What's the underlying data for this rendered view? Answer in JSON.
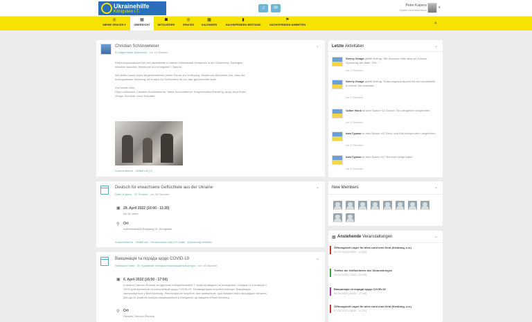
{
  "brand": {
    "name": "Ukrainehilfe",
    "sub": "Königstein i.T."
  },
  "user": {
    "name": "Peter Kuipers",
    "role": "System Administration"
  },
  "nav": [
    {
      "label": "Meine Spaces ▾",
      "icon": "◎"
    },
    {
      "label": "Übersicht",
      "icon": "▦"
    },
    {
      "label": "Mitglieder",
      "icon": "☗"
    },
    {
      "label": "Spaces",
      "icon": "◎"
    },
    {
      "label": "Kalender",
      "icon": "▦"
    },
    {
      "label": "Sachspenden Bestand",
      "icon": "▮"
    },
    {
      "label": "Sachspenden anbieten",
      "icon": "⚑"
    }
  ],
  "posts": [
    {
      "author": "Christian Schönwetener",
      "space": "01 Allgemeiner Austausch",
      "time": "vor 14 Stunden",
      "body": [
        "Erfahrungsaustausch mit der Ukrainehilfe in meiner Heimatstadt Hersbruck in der Schönbera. Synergien",
        "schaffen zwischen Hersbruck und Königstein / Taunus.",
        "",
        "Wir stellen unser super angenommenes Online-Forum zur Verfügung. Hersbruck informierte uns, dass die",
        "Kreisspartasse Nürnberg die Kosten für Geflüchtete für ein Jahr gebührenfrei stellt.",
        "",
        "Von rechts links:",
        "Lilya Luchanska, Christian Schönwetener, Stella Schönwetener, Bürgermeister Robert Ig, Andy Jörgl Roller,",
        "Gregor Schuster, Anna Schuster."
      ],
      "links": "Kommentieren · Gefällt mir (1)"
    },
    {
      "title": "Deutsch für erwachsene Geflüchtete aus der Ukraine",
      "author": "Peter Kuipers",
      "space": "07 Termine",
      "time": "vor 16 Stunden",
      "date": "29. April 2022 (10:00 - 11:30)",
      "date_sub": "Ab 15 Jahre",
      "loc_label": "Ort",
      "loc": "Adelheidstraße Burgweg 16, Königstein",
      "links": "Kommentieren · Gefällt mir · Herunterladen als ICS Datei · Erinnerung erstellen"
    },
    {
      "title": "Вакцинація та порада щодо COVID-19",
      "author": "Sebastian Hahn",
      "space": "09 Праківний телефон/Інформаційний ресурс",
      "time": "vor 16 Stunden",
      "date": "6. April 2022 (16:00 - 17:00)",
      "body": [
        "у лікарні Святого Йосипа за адресою Königsteinstraße 7 лікарі проводять на понеділках, середах та п'ятницях з",
        "14:00 для щеплення та консультацій щодо COVID-19. На вакцинацію потрібен паспорт. Вакцинація",
        "застосовується у Bad Homburg. Реєстрація не потрібна, але запишіться, щоб вказати якісь процедурні питання.",
        "Діти до 12 років не можуть вакцинуватися в Königstein, це вакцина в Bad Homburg."
      ],
      "loc_label": "Ort",
      "loc": "Лікарня Святого Йосипа"
    }
  ],
  "activities": {
    "title_bold": "Letzte",
    "title_rest": "Aktivitäten",
    "items": [
      {
        "name": "Sherry Visage",
        "text": "gefällt Beitrag \"Wir brauchen bitte alles an Outdoor Sportzeug wie Bälle, Frei...\"",
        "time": "vor 2 Stunden"
      },
      {
        "name": "Sherry Visage",
        "text": "gefällt Beitrag \"Erfahrungsaus-tausch mit der Ukrainehilfe in meiner Hei-matstadt...\"",
        "time": "vor 2 Stunden"
      },
      {
        "name": "Volker Hock",
        "text": "ist dem Space «13 Schule / Kin-dergarten» beigetreten",
        "time": "vor 4 Stunden"
      },
      {
        "name": "Іоко Гуреко",
        "text": "ist dem Space «02 Sach- und Klei-derspenden» beigetreten",
        "time": "vor 8 Stunden"
      },
      {
        "name": "Іоко Гуреко",
        "text": "ist dem Space «07 Termine» beige-treten",
        "time": "vor 8 Stunden"
      }
    ]
  },
  "members": {
    "title": "New Members"
  },
  "events": {
    "title_bold": "Anstehende",
    "title_rest": "Veranstaltungen",
    "items": [
      {
        "title": "Öffnungszeit Lager für alles rund ums Kind (Kleidung, u.a.)",
        "date": "05.04.2022 (08:00 - 11:00)"
      },
      {
        "title": "Treffen der Geflüchteten des Ukrainekrieges",
        "date": "05.04.2022 (18:00 - 20:00)"
      },
      {
        "title": "Вакцинація та порада щодо COVID-19",
        "date": "06.04.2022 (16:00 - 17:00)"
      },
      {
        "title": "Öffnungszeit Lager für alles rund ums Kind (Kleidung, u.a.)",
        "date": "07.04.2022 (08:00 - 11:00)"
      }
    ]
  }
}
